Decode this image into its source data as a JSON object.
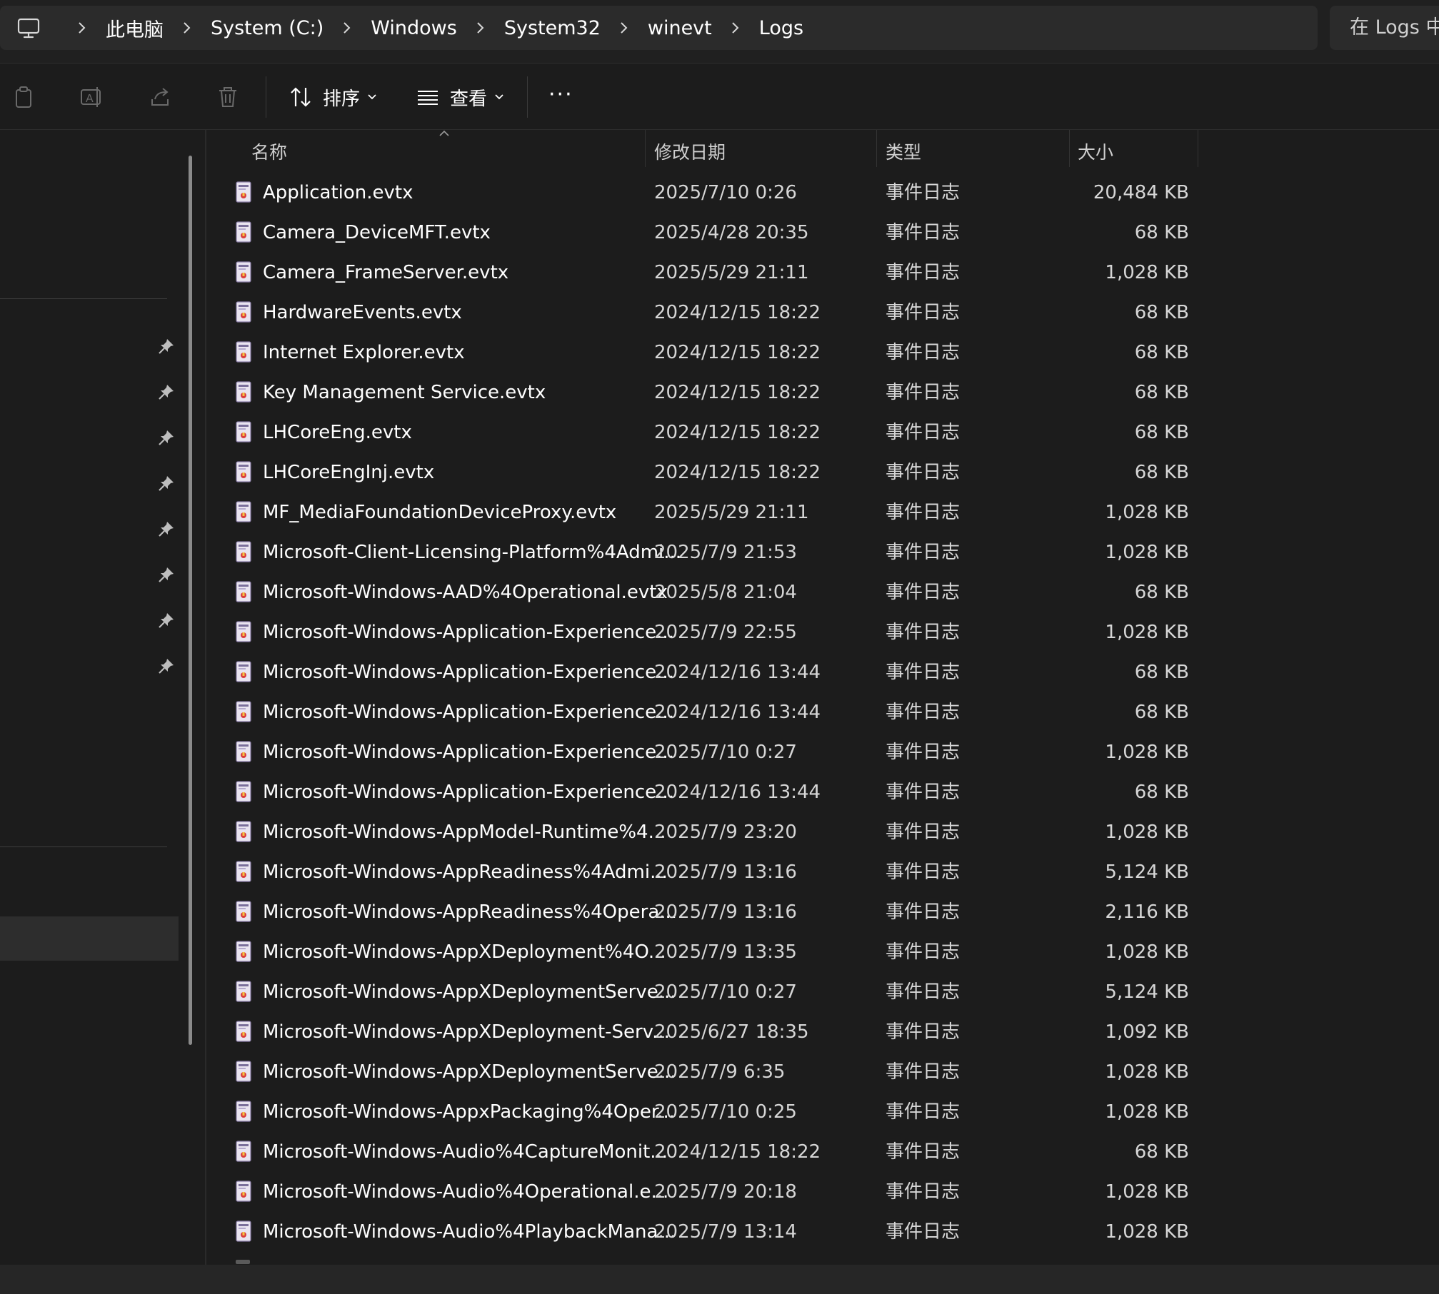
{
  "breadcrumbs": [
    "此电脑",
    "System (C:)",
    "Windows",
    "System32",
    "winevt",
    "Logs"
  ],
  "search": {
    "placeholder": "在 Logs 中"
  },
  "toolbar": {
    "sort_label": "排序",
    "view_label": "查看",
    "more_label": "···"
  },
  "columns": {
    "name": "名称",
    "date": "修改日期",
    "type": "类型",
    "size": "大小"
  },
  "files": [
    {
      "name": "Application.evtx",
      "date": "2025/7/10 0:26",
      "type": "事件日志",
      "size": "20,484 KB"
    },
    {
      "name": "Camera_DeviceMFT.evtx",
      "date": "2025/4/28 20:35",
      "type": "事件日志",
      "size": "68 KB"
    },
    {
      "name": "Camera_FrameServer.evtx",
      "date": "2025/5/29 21:11",
      "type": "事件日志",
      "size": "1,028 KB"
    },
    {
      "name": "HardwareEvents.evtx",
      "date": "2024/12/15 18:22",
      "type": "事件日志",
      "size": "68 KB"
    },
    {
      "name": "Internet Explorer.evtx",
      "date": "2024/12/15 18:22",
      "type": "事件日志",
      "size": "68 KB"
    },
    {
      "name": "Key Management Service.evtx",
      "date": "2024/12/15 18:22",
      "type": "事件日志",
      "size": "68 KB"
    },
    {
      "name": "LHCoreEng.evtx",
      "date": "2024/12/15 18:22",
      "type": "事件日志",
      "size": "68 KB"
    },
    {
      "name": "LHCoreEngInj.evtx",
      "date": "2024/12/15 18:22",
      "type": "事件日志",
      "size": "68 KB"
    },
    {
      "name": "MF_MediaFoundationDeviceProxy.evtx",
      "date": "2025/5/29 21:11",
      "type": "事件日志",
      "size": "1,028 KB"
    },
    {
      "name": "Microsoft-Client-Licensing-Platform%4Admi...",
      "date": "2025/7/9 21:53",
      "type": "事件日志",
      "size": "1,028 KB"
    },
    {
      "name": "Microsoft-Windows-AAD%4Operational.evtx",
      "date": "2025/5/8 21:04",
      "type": "事件日志",
      "size": "68 KB"
    },
    {
      "name": "Microsoft-Windows-Application-Experience...",
      "date": "2025/7/9 22:55",
      "type": "事件日志",
      "size": "1,028 KB"
    },
    {
      "name": "Microsoft-Windows-Application-Experience...",
      "date": "2024/12/16 13:44",
      "type": "事件日志",
      "size": "68 KB"
    },
    {
      "name": "Microsoft-Windows-Application-Experience...",
      "date": "2024/12/16 13:44",
      "type": "事件日志",
      "size": "68 KB"
    },
    {
      "name": "Microsoft-Windows-Application-Experience...",
      "date": "2025/7/10 0:27",
      "type": "事件日志",
      "size": "1,028 KB"
    },
    {
      "name": "Microsoft-Windows-Application-Experience...",
      "date": "2024/12/16 13:44",
      "type": "事件日志",
      "size": "68 KB"
    },
    {
      "name": "Microsoft-Windows-AppModel-Runtime%4...",
      "date": "2025/7/9 23:20",
      "type": "事件日志",
      "size": "1,028 KB"
    },
    {
      "name": "Microsoft-Windows-AppReadiness%4Admi...",
      "date": "2025/7/9 13:16",
      "type": "事件日志",
      "size": "5,124 KB"
    },
    {
      "name": "Microsoft-Windows-AppReadiness%4Opera...",
      "date": "2025/7/9 13:16",
      "type": "事件日志",
      "size": "2,116 KB"
    },
    {
      "name": "Microsoft-Windows-AppXDeployment%4O...",
      "date": "2025/7/9 13:35",
      "type": "事件日志",
      "size": "1,028 KB"
    },
    {
      "name": "Microsoft-Windows-AppXDeploymentServe...",
      "date": "2025/7/10 0:27",
      "type": "事件日志",
      "size": "5,124 KB"
    },
    {
      "name": "Microsoft-Windows-AppXDeployment-Serv...",
      "date": "2025/6/27 18:35",
      "type": "事件日志",
      "size": "1,092 KB"
    },
    {
      "name": "Microsoft-Windows-AppXDeploymentServe...",
      "date": "2025/7/9 6:35",
      "type": "事件日志",
      "size": "1,028 KB"
    },
    {
      "name": "Microsoft-Windows-AppxPackaging%4Oper...",
      "date": "2025/7/10 0:25",
      "type": "事件日志",
      "size": "1,028 KB"
    },
    {
      "name": "Microsoft-Windows-Audio%4CaptureMonit...",
      "date": "2024/12/15 18:22",
      "type": "事件日志",
      "size": "68 KB"
    },
    {
      "name": "Microsoft-Windows-Audio%4Operational.e...",
      "date": "2025/7/9 20:18",
      "type": "事件日志",
      "size": "1,028 KB"
    },
    {
      "name": "Microsoft-Windows-Audio%4PlaybackMana...",
      "date": "2025/7/9 13:14",
      "type": "事件日志",
      "size": "1,028 KB"
    }
  ],
  "icons": {
    "computer": "computer-icon",
    "chevron": "chevron-right-icon",
    "copy": "copy-icon",
    "rename": "rename-icon",
    "share": "share-icon",
    "delete": "delete-icon",
    "sort": "sort-icon",
    "view": "view-list-icon",
    "more": "more-icon",
    "pin": "pin-icon",
    "file": "event-log-file-icon"
  },
  "colors": {
    "background": "#1c1c1c",
    "panel": "#2b2b2b",
    "text": "#ffffff",
    "muted": "#d6d6d6"
  }
}
